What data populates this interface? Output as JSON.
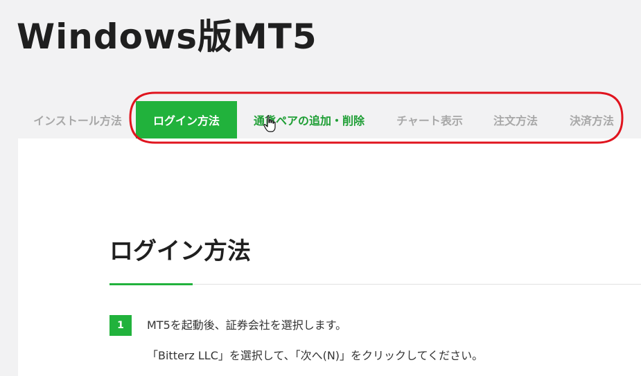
{
  "page": {
    "title": "Windows版MT5"
  },
  "tabs": [
    {
      "label": "インストール方法",
      "state": "inactive"
    },
    {
      "label": "ログイン方法",
      "state": "active"
    },
    {
      "label": "通貨ペアの追加・削除",
      "state": "hover"
    },
    {
      "label": "チャート表示",
      "state": "inactive"
    },
    {
      "label": "注文方法",
      "state": "inactive"
    },
    {
      "label": "決済方法",
      "state": "inactive"
    }
  ],
  "section": {
    "title": "ログイン方法"
  },
  "steps": [
    {
      "number": "1",
      "line1": "MT5を起動後、証券会社を選択します。",
      "line2": "「Bitterz LLC」を選択して、「次へ(N)」をクリックしてください。"
    }
  ],
  "colors": {
    "accent": "#21b23c",
    "annotation": "#e0141e",
    "inactive_tab": "#a8a8a8",
    "background": "#f2f2f3"
  },
  "icons": {
    "cursor": "hand-pointer-icon"
  }
}
